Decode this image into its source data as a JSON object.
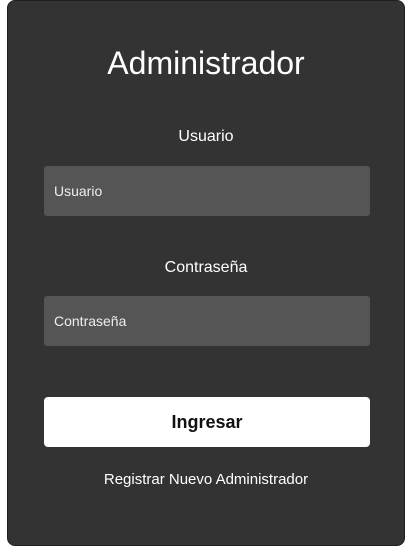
{
  "login": {
    "title": "Administrador",
    "username_label": "Usuario",
    "username_placeholder": "Usuario",
    "username_value": "",
    "password_label": "Contraseña",
    "password_placeholder": "Contraseña",
    "password_value": "",
    "submit_label": "Ingresar",
    "register_link": "Registrar Nuevo Administrador"
  },
  "colors": {
    "card_background": "#333333",
    "input_background": "#555555",
    "button_background": "#ffffff",
    "text": "#ffffff"
  }
}
